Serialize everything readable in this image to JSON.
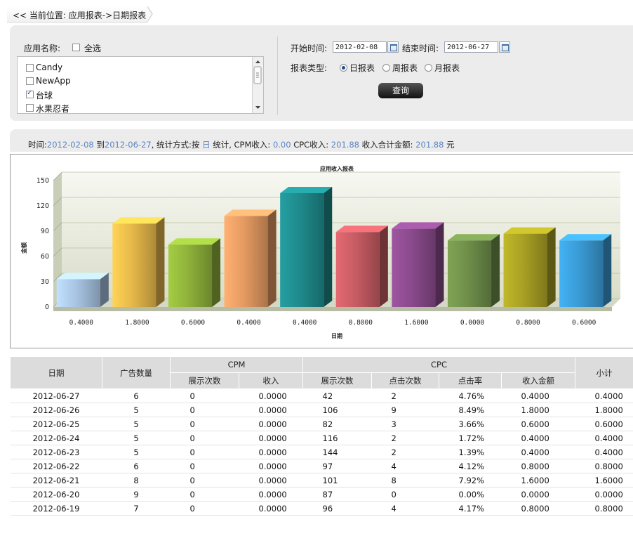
{
  "breadcrumb": "<< 当前位置: 应用报表->日期报表",
  "filter": {
    "app_name_label": "应用名称:",
    "select_all_label": "全选",
    "apps": [
      {
        "name": "Candy",
        "checked": false
      },
      {
        "name": "NewApp",
        "checked": false
      },
      {
        "name": "台球",
        "checked": true
      },
      {
        "name": "水果忍者",
        "checked": false
      }
    ],
    "start_label": "开始时间:",
    "start_value": "2012-02-08",
    "end_label": "结束时间:",
    "end_value": "2012-06-27",
    "report_type_label": "报表类型:",
    "report_types": [
      {
        "label": "日报表",
        "selected": true
      },
      {
        "label": "周报表",
        "selected": false
      },
      {
        "label": "月报表",
        "selected": false
      }
    ],
    "query_label": "查询"
  },
  "summary": {
    "prefix": "时间:",
    "start": "2012-02-08",
    "to": "到",
    "end": "2012-06-27",
    "method_text": ", 统计方式:按",
    "unit": "日",
    "stat_text": "统计, CPM收入:",
    "cpm": "0.00",
    "cpc_label": "CPC收入:",
    "cpc": "201.88",
    "total_label": "收入合计金额:",
    "total": "201.88",
    "currency": "元"
  },
  "chart_data": {
    "type": "bar",
    "title": "应用收入报表",
    "xlabel": "日期",
    "ylabel": "金额",
    "ylim": [
      0,
      150
    ],
    "yticks": [
      0,
      30,
      60,
      90,
      120,
      150
    ],
    "categories": [
      "0.4000",
      "1.8000",
      "0.6000",
      "0.4000",
      "0.4000",
      "0.8000",
      "1.6000",
      "0.0000",
      "0.8000",
      "0.6000"
    ],
    "values": [
      33,
      99,
      74,
      108,
      135,
      89,
      93,
      79,
      87,
      79
    ],
    "colors": [
      "#a8c4e3",
      "#e6b84a",
      "#8fb23a",
      "#e59a62",
      "#1f8a8c",
      "#c65c63",
      "#8a4a8c",
      "#6f8f4a",
      "#a8a024",
      "#3a9bd5"
    ]
  },
  "table": {
    "headers": {
      "date": "日期",
      "ads": "广告数量",
      "cpm": "CPM",
      "cpm_impr": "展示次数",
      "cpm_income": "收入",
      "cpc": "CPC",
      "cpc_impr": "展示次数",
      "cpc_clicks": "点击次数",
      "cpc_ctr": "点击率",
      "cpc_income": "收入金额",
      "subtotal": "小计"
    },
    "rows": [
      [
        "2012-06-27",
        "6",
        "0",
        "0.0000",
        "42",
        "2",
        "4.76%",
        "0.4000",
        "0.4000"
      ],
      [
        "2012-06-26",
        "5",
        "0",
        "0.0000",
        "106",
        "9",
        "8.49%",
        "1.8000",
        "1.8000"
      ],
      [
        "2012-06-25",
        "5",
        "0",
        "0.0000",
        "82",
        "3",
        "3.66%",
        "0.6000",
        "0.6000"
      ],
      [
        "2012-06-24",
        "5",
        "0",
        "0.0000",
        "116",
        "2",
        "1.72%",
        "0.4000",
        "0.4000"
      ],
      [
        "2012-06-23",
        "5",
        "0",
        "0.0000",
        "144",
        "2",
        "1.39%",
        "0.4000",
        "0.4000"
      ],
      [
        "2012-06-22",
        "6",
        "0",
        "0.0000",
        "97",
        "4",
        "4.12%",
        "0.8000",
        "0.8000"
      ],
      [
        "2012-06-21",
        "8",
        "0",
        "0.0000",
        "101",
        "8",
        "7.92%",
        "1.6000",
        "1.6000"
      ],
      [
        "2012-06-20",
        "9",
        "0",
        "0.0000",
        "87",
        "0",
        "0.00%",
        "0.0000",
        "0.0000"
      ],
      [
        "2012-06-19",
        "7",
        "0",
        "0.0000",
        "96",
        "4",
        "4.17%",
        "0.8000",
        "0.8000"
      ]
    ]
  }
}
